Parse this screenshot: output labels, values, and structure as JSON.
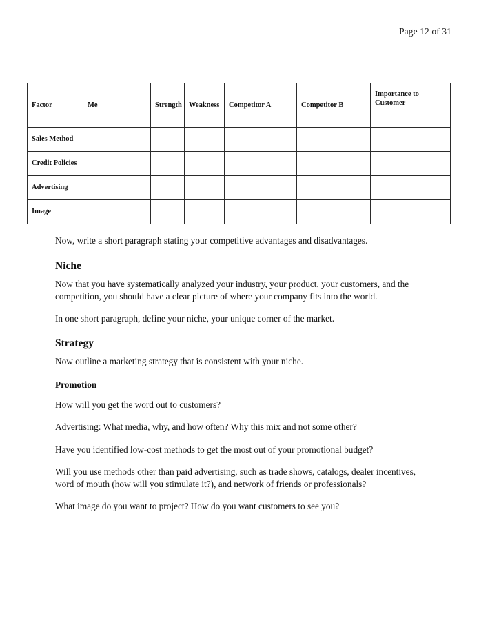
{
  "header": {
    "page_label": "Page 12 of 31"
  },
  "table": {
    "columns": [
      "Factor",
      "Me",
      "Strength",
      "Weakness",
      "Competitor A",
      "Competitor B",
      "Importance to Customer"
    ],
    "rows": [
      {
        "factor": "Sales Method",
        "me": "",
        "strength": "",
        "weakness": "",
        "competitor_a": "",
        "competitor_b": "",
        "importance": ""
      },
      {
        "factor": "Credit Policies",
        "me": "",
        "strength": "",
        "weakness": "",
        "competitor_a": "",
        "competitor_b": "",
        "importance": ""
      },
      {
        "factor": "Advertising",
        "me": "",
        "strength": "",
        "weakness": "",
        "competitor_a": "",
        "competitor_b": "",
        "importance": ""
      },
      {
        "factor": "Image",
        "me": "",
        "strength": "",
        "weakness": "",
        "competitor_a": "",
        "competitor_b": "",
        "importance": ""
      }
    ]
  },
  "body": {
    "intro_paragraph": "Now, write a short paragraph stating your competitive advantages and disadvantages.",
    "niche_heading": "Niche",
    "niche_paragraph_1": "Now that you have systematically analyzed your industry, your product, your customers, and the competition, you should have a clear picture of where your company fits into the world.",
    "niche_paragraph_2": "In one short paragraph, define your niche, your unique corner of the market.",
    "strategy_heading": "Strategy",
    "strategy_paragraph": "Now outline a marketing strategy that is consistent with your niche.",
    "promotion_heading": "Promotion",
    "promotion_paragraph_1": "How will you get the word out to customers?",
    "promotion_paragraph_2": "Advertising: What media, why, and how often? Why this mix and not some other?",
    "promotion_paragraph_3": "Have you identified low-cost methods to get the most out of your promotional budget?",
    "promotion_paragraph_4": "Will you use methods other than paid advertising, such as trade shows, catalogs, dealer incentives, word of mouth (how will you stimulate it?), and network of friends or professionals?",
    "promotion_paragraph_5": "What image do you want to project? How do you want customers to see you?"
  }
}
